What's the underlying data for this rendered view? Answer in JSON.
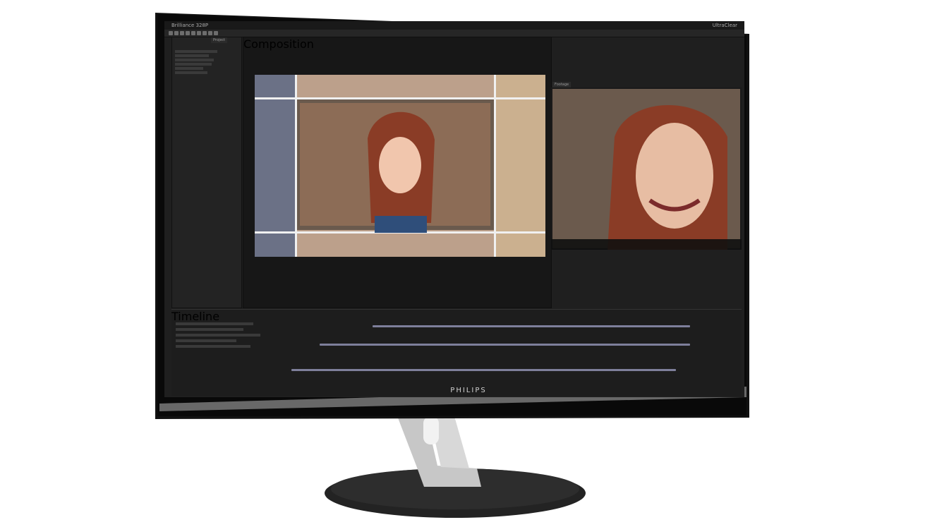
{
  "device": {
    "brand": "PHILIPS",
    "screen_label": "Brilliance 328P",
    "corner_label": "UltraClear"
  },
  "app": {
    "panels": {
      "project_tab": "Project",
      "comp_tab": "Composition",
      "footage_tab": "Footage",
      "timeline_tab": "Timeline"
    }
  },
  "colors": {
    "bezel": "#0d0d0d",
    "screen_bg": "#1f1f1f",
    "track": "#7e7f9b",
    "stand": "#b8b8b8",
    "base": "#262626"
  }
}
